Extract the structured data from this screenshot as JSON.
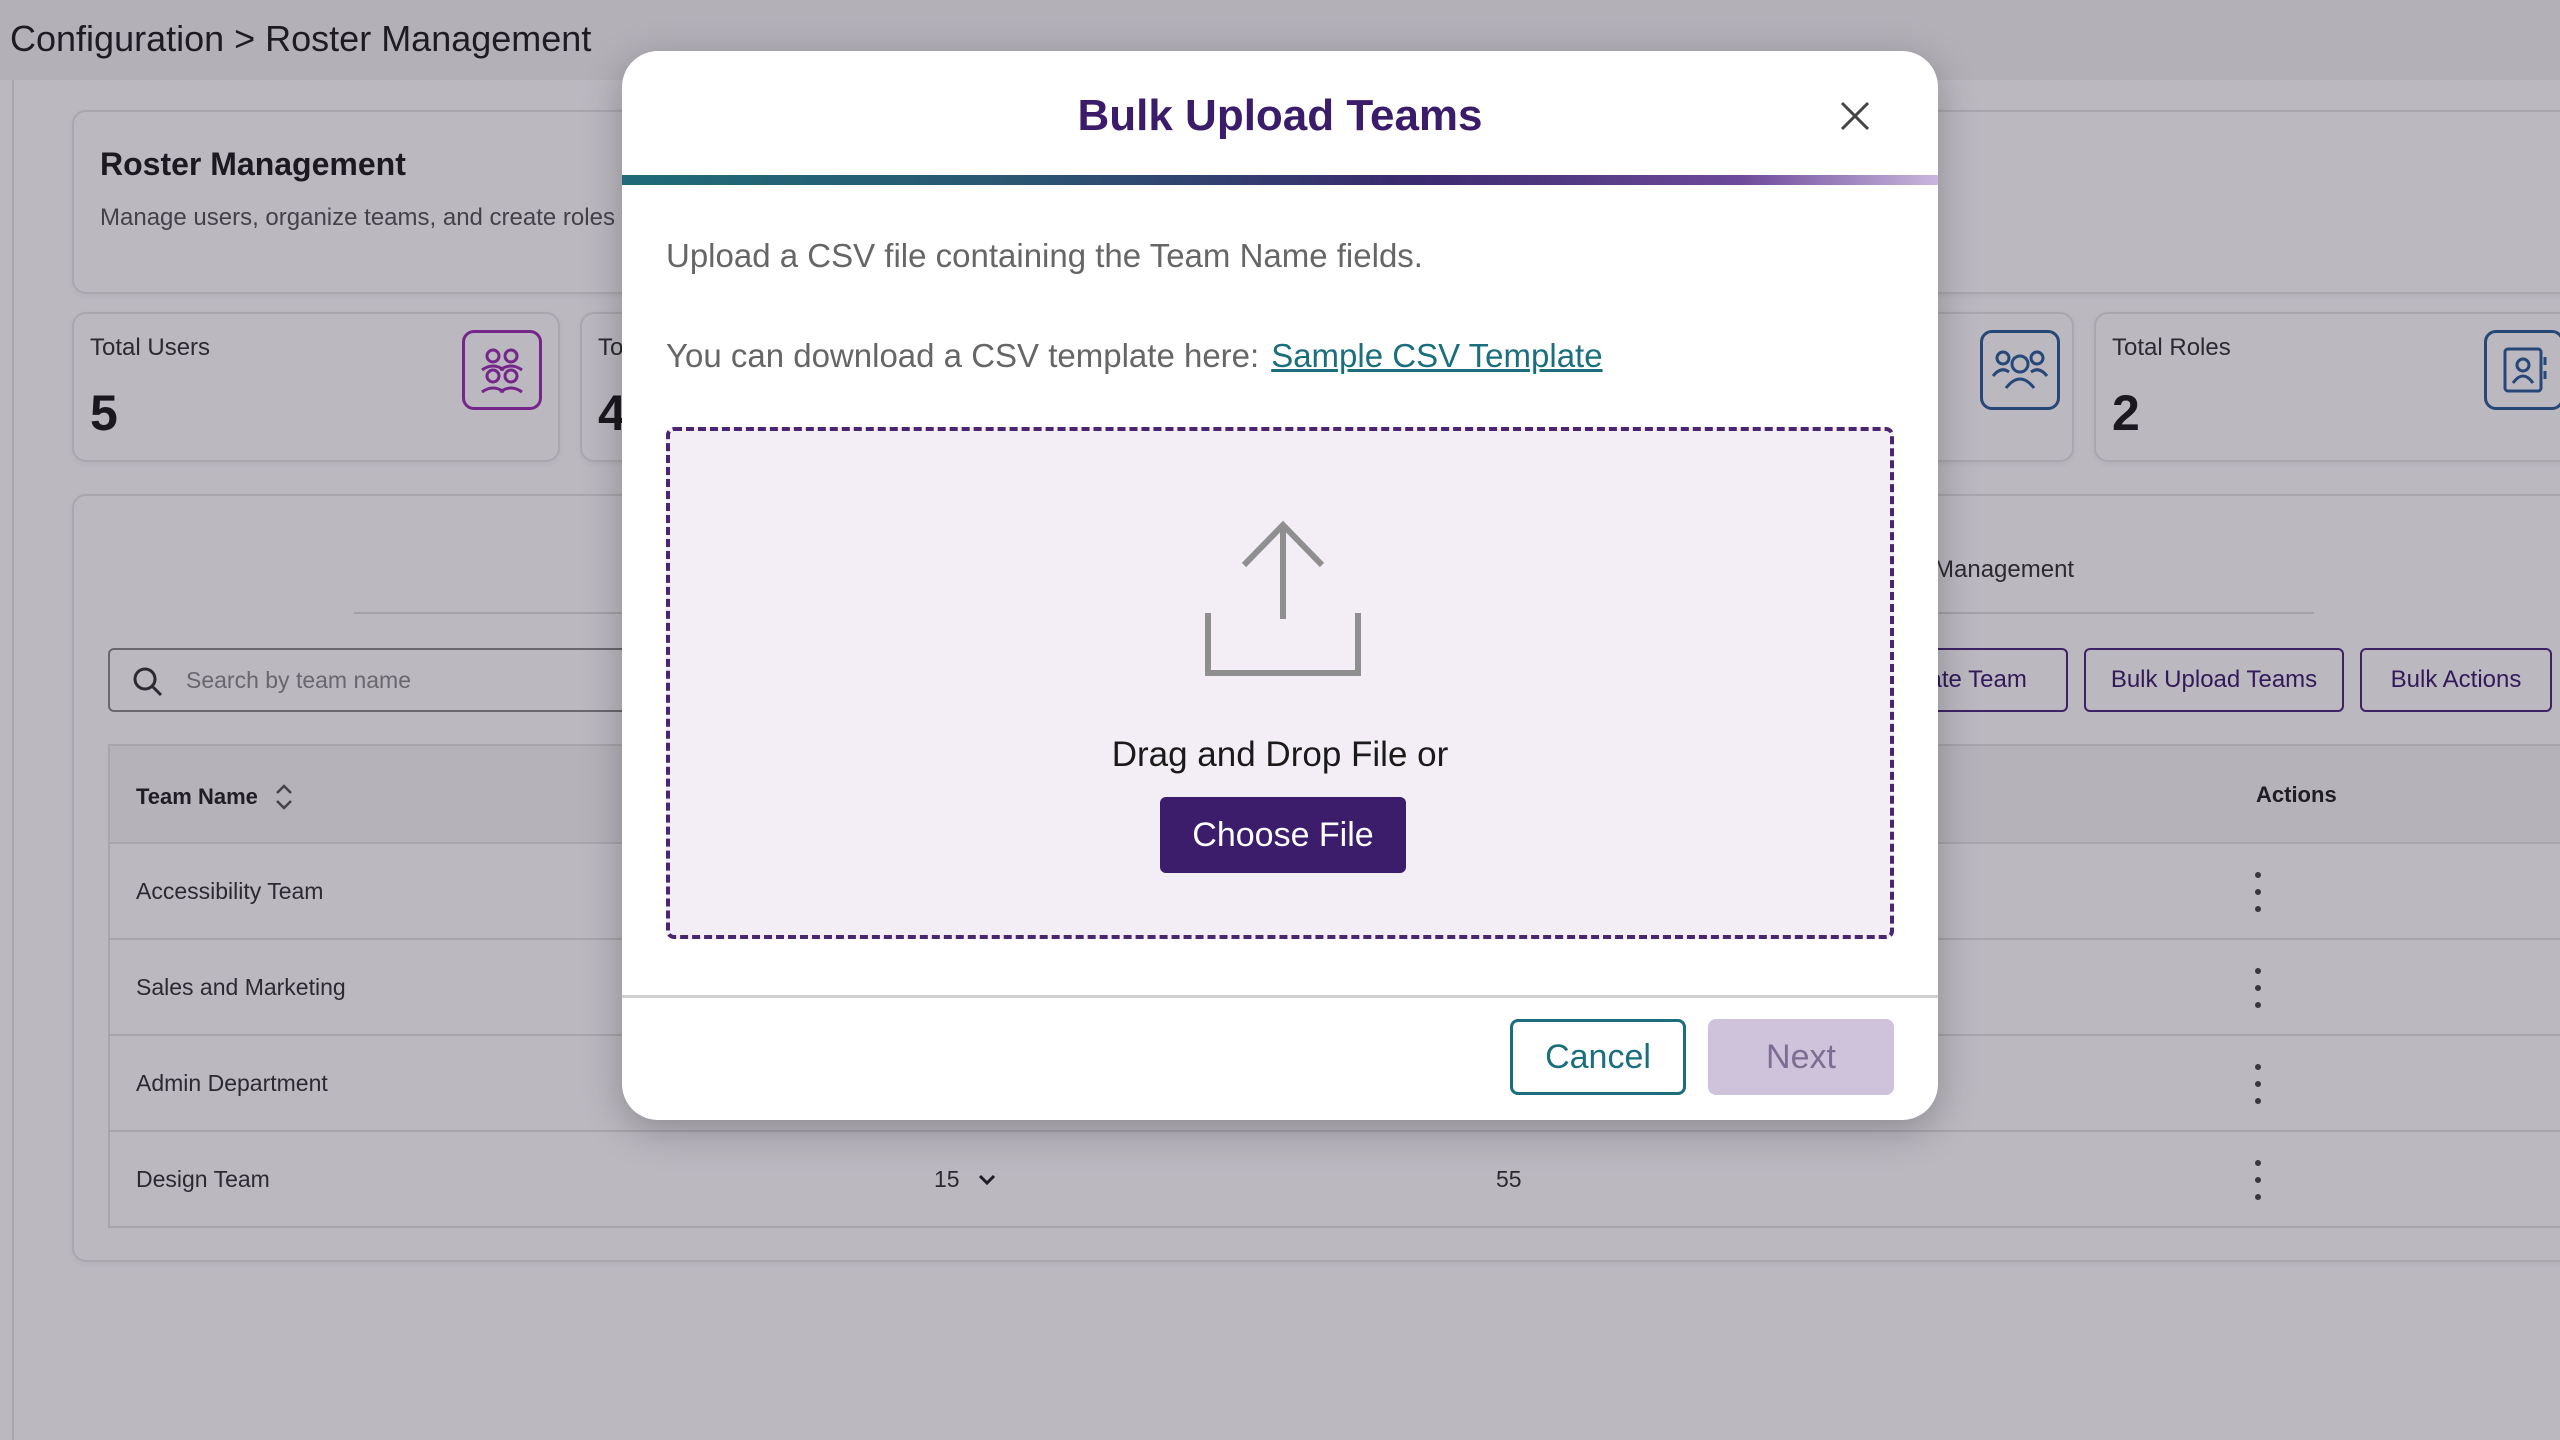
{
  "page": {
    "breadcrumb": "Configuration > Roster Management"
  },
  "header": {
    "title": "Roster Management",
    "description": "Manage users, organize teams, and create roles w"
  },
  "stats": [
    {
      "label": "Total Users",
      "value": "5",
      "icon": "users-group-icon",
      "color": "#9b30b0"
    },
    {
      "label": "To",
      "value": "4",
      "icon": "",
      "color": ""
    },
    {
      "label": "",
      "value": "",
      "icon": "team-icon",
      "color": "#2b5e96"
    },
    {
      "label": "Total Roles",
      "value": "2",
      "icon": "contact-card-icon",
      "color": "#2b5e96"
    }
  ],
  "tabs": {
    "visible_label": "Management"
  },
  "search": {
    "placeholder": "Search by team name"
  },
  "toolbar": {
    "create_label": "eate Team",
    "bulk_upload_label": "Bulk Upload Teams",
    "bulk_actions_label": "Bulk Actions"
  },
  "table": {
    "columns": {
      "team_name": "Team Name",
      "actions": "Actions"
    },
    "rows": [
      {
        "name": "Accessibility Team",
        "count": "",
        "value": ""
      },
      {
        "name": "Sales and Marketing",
        "count": "",
        "value": ""
      },
      {
        "name": "Admin Department",
        "count": "",
        "value": ""
      },
      {
        "name": "Design Team",
        "count": "15",
        "value": "55"
      }
    ]
  },
  "modal": {
    "title": "Bulk Upload Teams",
    "instruction": "Upload a CSV file containing the Team Name fields.",
    "template_prefix": "You can download a CSV template here:",
    "template_link": "Sample CSV Template",
    "drop_text": "Drag and Drop File or",
    "choose_label": "Choose File",
    "cancel_label": "Cancel",
    "next_label": "Next"
  },
  "colors": {
    "brand_purple": "#3c1d6b",
    "teal": "#1b6f7d",
    "dropzone_bg": "#f3edf5"
  }
}
